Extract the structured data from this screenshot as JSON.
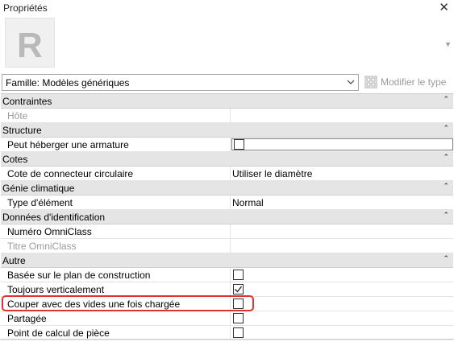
{
  "window": {
    "title": "Propriétés",
    "close_icon": "close-icon"
  },
  "type_selector": {
    "logo_letter": "R"
  },
  "family": {
    "selected": "Famille: Modèles génériques",
    "edit_type_label": "Modifier le type"
  },
  "groups": [
    {
      "title": "Contraintes",
      "rows": [
        {
          "name": "Hôte",
          "disabled": true
        }
      ]
    },
    {
      "title": "Structure",
      "rows": [
        {
          "name": "Peut héberger une armature",
          "checkbox": false
        }
      ]
    },
    {
      "title": "Cotes",
      "rows": [
        {
          "name": "Cote de connecteur circulaire",
          "value": "Utiliser le diamètre"
        }
      ]
    },
    {
      "title": "Génie climatique",
      "rows": [
        {
          "name": "Type d'élément",
          "value": "Normal"
        }
      ]
    },
    {
      "title": "Données d'identification",
      "rows": [
        {
          "name": "Numéro OmniClass"
        },
        {
          "name": "Titre OmniClass",
          "disabled": true
        }
      ]
    },
    {
      "title": "Autre",
      "rows": [
        {
          "name": "Basée sur le plan de construction",
          "checkbox": false
        },
        {
          "name": "Toujours verticalement",
          "checkbox": true
        },
        {
          "name": "Couper avec des vides une fois chargée",
          "checkbox": false
        },
        {
          "name": "Partagée",
          "checkbox": false
        },
        {
          "name": "Point de calcul de pièce",
          "checkbox": false
        }
      ]
    }
  ],
  "colors": {
    "highlight": "#e03030",
    "group_bg": "#e5e5e5"
  }
}
